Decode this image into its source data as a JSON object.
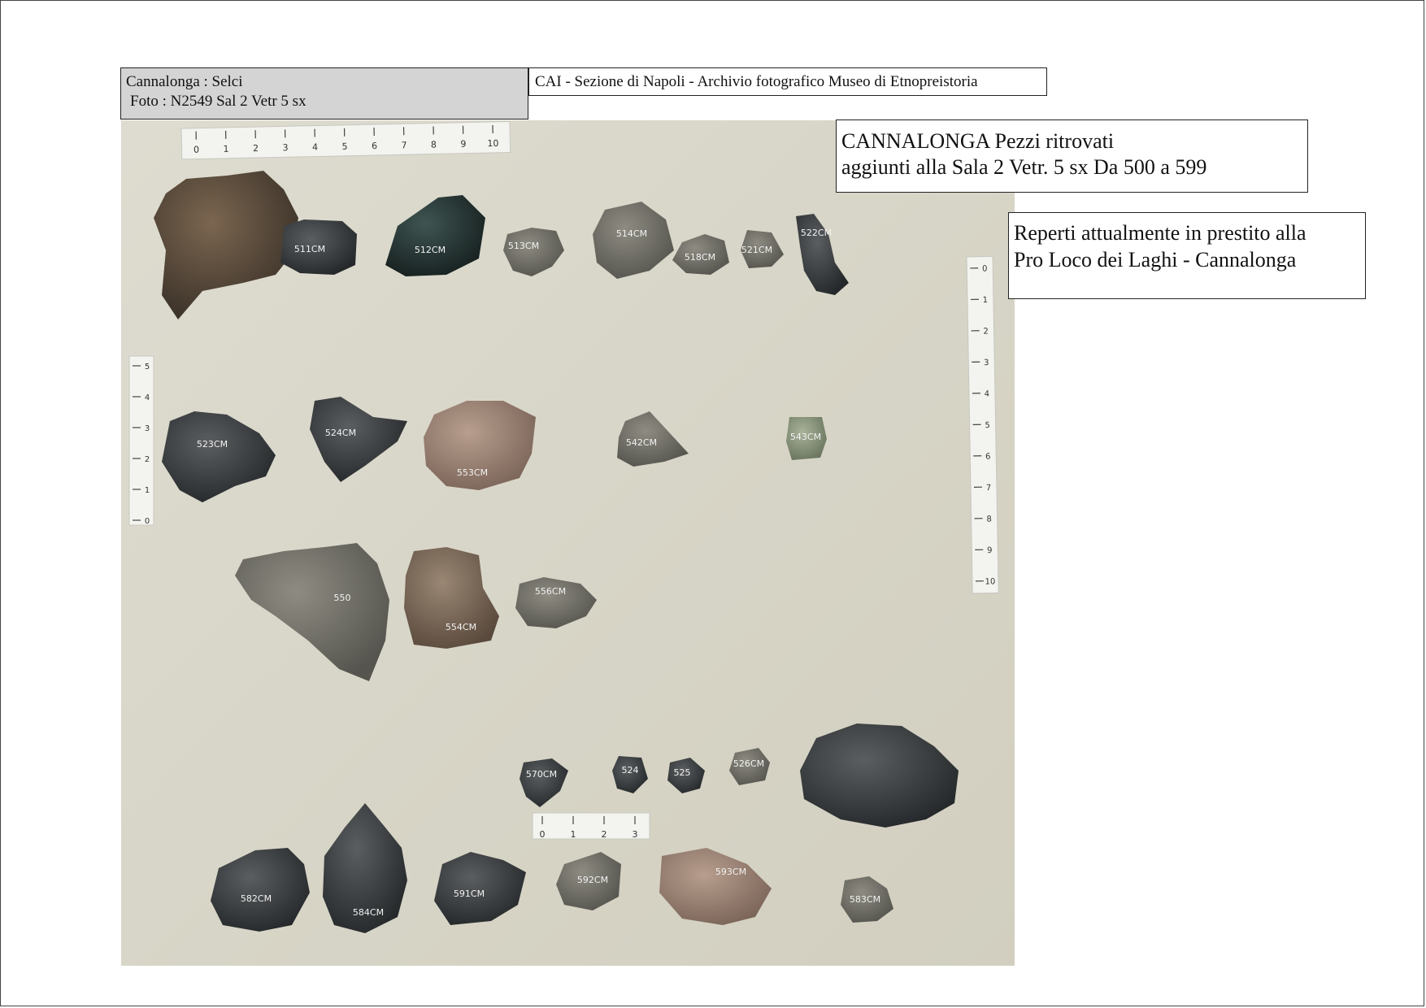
{
  "header": {
    "left_line1": "Cannalonga  :  Selci",
    "left_line2": "Foto : N2549    Sal 2 Vetr 5 sx",
    "archive": "CAI - Sezione di Napoli  - Archivio fotografico Museo di Etnopreistoria"
  },
  "title_box": {
    "line1": "CANNALONGA Pezzi ritrovati",
    "line2": "aggiunti alla   Sala 2  Vetr. 5 sx      Da 500 a 599"
  },
  "loan_box": {
    "line1": "Reperti attualmente in prestito alla",
    "line2": "Pro Loco dei Laghi - Cannalonga"
  },
  "photo": {
    "background_color": "#dad8cb",
    "ruler_top_ticks": [
      "0",
      "1",
      "2",
      "3",
      "4",
      "5",
      "6",
      "7",
      "8",
      "9",
      "10"
    ],
    "ruler_left_ticks": [
      "0",
      "1",
      "2",
      "3",
      "4",
      "5"
    ],
    "ruler_right_ticks": [
      "0",
      "1",
      "2",
      "3",
      "4",
      "5",
      "6",
      "7",
      "8",
      "9",
      "10"
    ],
    "ruler_bottom_ticks": [
      "0",
      "1",
      "2",
      "3"
    ],
    "artifact_labels": [
      "511CM",
      "512CM",
      "513CM",
      "514CM",
      "518CM",
      "521CM",
      "522CM",
      "523CM",
      "524CM",
      "553CM",
      "542CM",
      "543CM",
      "550",
      "554CM",
      "556CM",
      "570CM",
      "524",
      "525",
      "526CM",
      "582CM",
      "584CM",
      "591CM",
      "592CM",
      "593CM",
      "583CM"
    ]
  }
}
